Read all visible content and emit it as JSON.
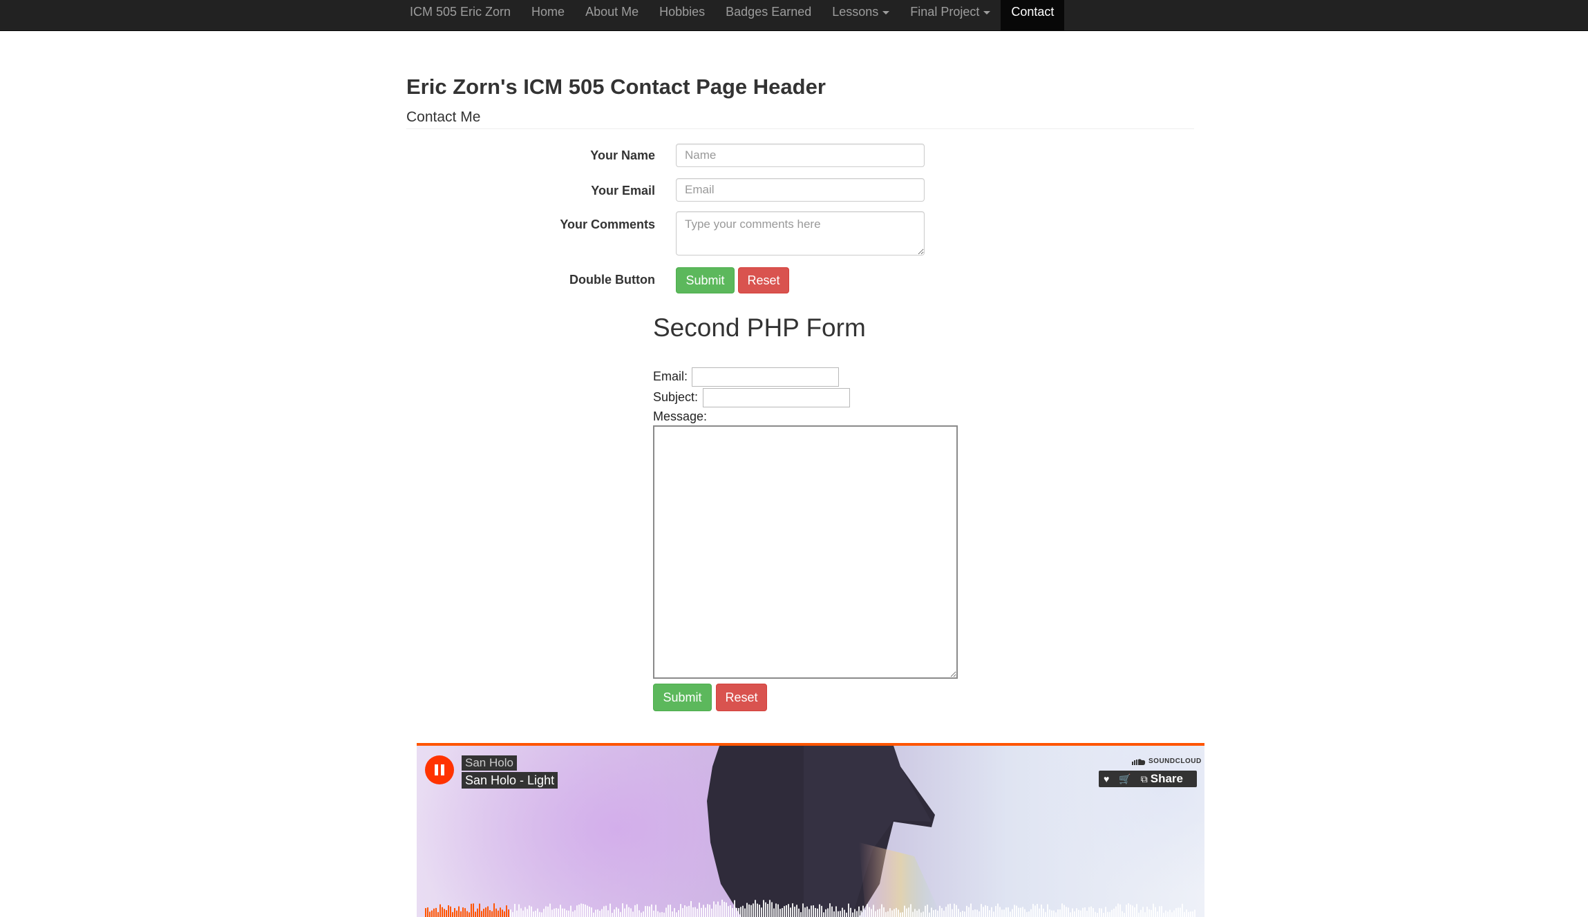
{
  "nav": {
    "brand": "ICM 505 Eric Zorn",
    "items": [
      "Home",
      "About Me",
      "Hobbies",
      "Badges Earned",
      "Lessons",
      "Final Project",
      "Contact"
    ],
    "active": "Contact"
  },
  "header": {
    "title": "Eric Zorn's ICM 505 Contact Page Header",
    "subtitle": "Contact Me"
  },
  "form1": {
    "name_label": "Your Name",
    "name_placeholder": "Name",
    "email_label": "Your Email",
    "email_placeholder": "Email",
    "comments_label": "Your Comments",
    "comments_placeholder": "Type your comments here",
    "buttons_label": "Double Button",
    "submit_label": "Submit",
    "reset_label": "Reset"
  },
  "form2": {
    "title": "Second PHP Form",
    "email_label": "Email:",
    "subject_label": "Subject:",
    "message_label": "Message:",
    "submit_label": "Submit",
    "reset_label": "Reset"
  },
  "player": {
    "artist": "San Holo",
    "track": "San Holo - Light",
    "logo_text": "SOUNDCLOUD",
    "share_label": "Share",
    "like_icon": "heart-icon",
    "buy_icon": "cart-icon",
    "share_icon": "share-icon",
    "progress": 0.11,
    "accent": "#ff5500"
  },
  "colors": {
    "navbar": "#222222",
    "nav_active": "#080808",
    "success": "#5cb85c",
    "danger": "#d9534f"
  }
}
